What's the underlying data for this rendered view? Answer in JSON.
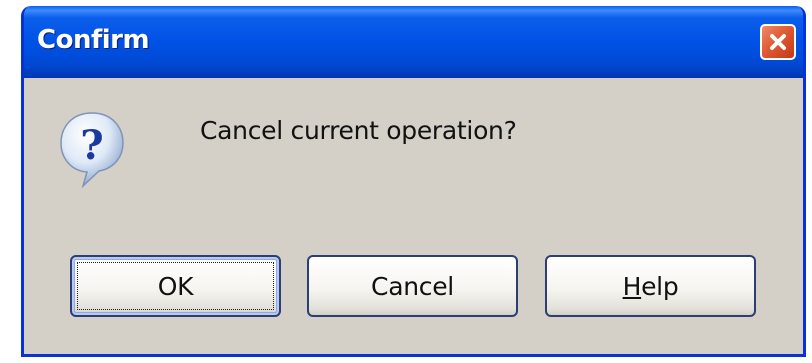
{
  "dialog": {
    "title": "Confirm",
    "message": "Cancel current operation?",
    "icon": "question-icon",
    "close_icon": "close-icon"
  },
  "buttons": {
    "ok_label": "OK",
    "cancel_label": "Cancel",
    "help_first_letter": "H",
    "help_rest": "elp"
  },
  "colors": {
    "titlebar": "#0052e6",
    "frame": "#0831d9",
    "body": "#d4d0c8",
    "close_button": "#e05a34",
    "button_border": "#2c3e74"
  }
}
